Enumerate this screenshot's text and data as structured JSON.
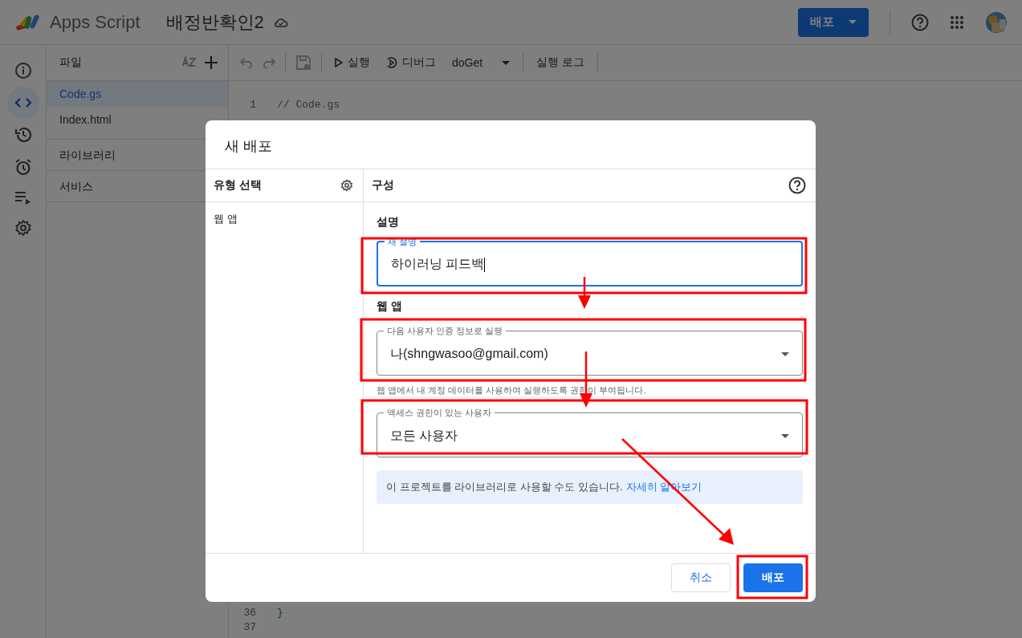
{
  "app": {
    "name": "Apps Script",
    "project_title": "배정반확인2"
  },
  "header": {
    "deploy_button": "배포"
  },
  "files_panel": {
    "title": "파일",
    "files": [
      {
        "name": "Code.gs",
        "selected": true
      },
      {
        "name": "Index.html",
        "selected": false
      }
    ],
    "sections": [
      "라이브러리",
      "서비스"
    ]
  },
  "toolbar": {
    "run": "실행",
    "debug": "디버그",
    "function": "doGet",
    "log": "실행 로그"
  },
  "code_top": [
    {
      "number": "1",
      "text": "// Code.gs"
    }
  ],
  "code_bottom": [
    {
      "number": "36",
      "text": "}"
    },
    {
      "number": "37"
    }
  ],
  "dialog": {
    "title": "새 배포",
    "type_header": "유형 선택",
    "types": [
      "웹 앱"
    ],
    "config_header": "구성",
    "description_section": "설명",
    "description_field": {
      "label": "새 설명",
      "value": "하이러닝 피드백"
    },
    "webapp_section": "웹 앱",
    "execute_as": {
      "label": "다음 사용자 인증 정보로 실행",
      "value": "나(shngwasoo@gmail.com)",
      "helper": "웹 앱에서 내 계정 데이터를 사용하여 실행하도록 권한이 부여됩니다."
    },
    "access": {
      "label": "액세스 권한이 있는 사용자",
      "value": "모든 사용자"
    },
    "info": {
      "text": "이 프로젝트를 라이브러리로 사용할 수도 있습니다.",
      "link": "자세히 알아보기"
    },
    "buttons": [
      {
        "label": "취소",
        "kind": "secondary"
      },
      {
        "label": "배포",
        "kind": "primary"
      }
    ]
  }
}
